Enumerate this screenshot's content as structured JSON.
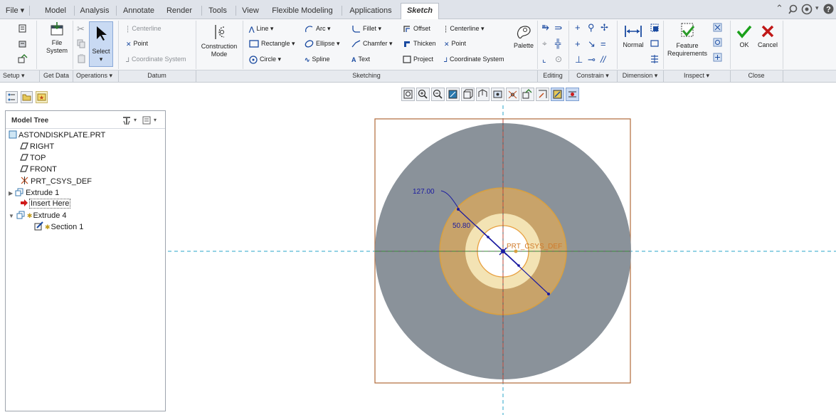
{
  "tabs": [
    {
      "id": "file",
      "label": "File ▾"
    },
    {
      "id": "model",
      "label": "Model"
    },
    {
      "id": "analysis",
      "label": "Analysis"
    },
    {
      "id": "annotate",
      "label": "Annotate"
    },
    {
      "id": "render",
      "label": "Render"
    },
    {
      "id": "tools",
      "label": "Tools"
    },
    {
      "id": "view",
      "label": "View"
    },
    {
      "id": "flexible",
      "label": "Flexible Modeling"
    },
    {
      "id": "applications",
      "label": "Applications"
    },
    {
      "id": "sketch",
      "label": "Sketch"
    }
  ],
  "ribbon": {
    "file_system": "File System",
    "file_system_l1": "File",
    "file_system_l2": "System",
    "select": "Select",
    "centerline": "Centerline",
    "point": "Point",
    "coord_system": "Coordinate System",
    "construction_l1": "Construction",
    "construction_l2": "Mode",
    "line": "Line ▾",
    "rectangle": "Rectangle ▾",
    "circle": "Circle ▾",
    "arc": "Arc ▾",
    "ellipse": "Ellipse ▾",
    "spline": "Spline",
    "fillet": "Fillet ▾",
    "chamfer": "Chamfer ▾",
    "text": "Text",
    "offset": "Offset",
    "thicken": "Thicken",
    "project": "Project",
    "centerline2": "Centerline ▾",
    "point2": "Point",
    "coord_system2": "Coordinate System",
    "palette": "Palette",
    "normal": "Normal",
    "feature_req_l1": "Feature",
    "feature_req_l2": "Requirements",
    "ok": "OK",
    "cancel": "Cancel"
  },
  "groups": {
    "setup": "Setup ▾",
    "get_data": "Get Data",
    "operations": "Operations ▾",
    "datum": "Datum",
    "sketching": "Sketching",
    "editing": "Editing",
    "constrain": "Constrain ▾",
    "dimension": "Dimension ▾",
    "inspect": "Inspect ▾",
    "close": "Close"
  },
  "model_tree": {
    "title": "Model Tree",
    "items": [
      {
        "label": "ASTONDISKPLATE.PRT",
        "icon": "part-icon"
      },
      {
        "label": "RIGHT",
        "icon": "datum-plane-icon"
      },
      {
        "label": "TOP",
        "icon": "datum-plane-icon"
      },
      {
        "label": "FRONT",
        "icon": "datum-plane-icon"
      },
      {
        "label": "PRT_CSYS_DEF",
        "icon": "csys-icon"
      },
      {
        "label": "Extrude 1",
        "icon": "extrude-icon"
      },
      {
        "label": "Insert Here",
        "icon": "insert-arrow-icon"
      },
      {
        "label": "Extrude 4",
        "icon": "extrude-icon"
      },
      {
        "label": "Section 1",
        "icon": "sketch-icon"
      }
    ]
  },
  "sketch": {
    "dim_outer": "127.00",
    "dim_inner": "50.80",
    "csys_label": "PRT_CSYS_DEF"
  },
  "colors": {
    "accent": "#c9daf3",
    "disk": "#8a929a",
    "ring": "#c8a36a",
    "hub": "#f3e3b4",
    "dimension": "#1a1aa0",
    "axis": "#2aa5c8",
    "frame": "#b06a3a"
  }
}
